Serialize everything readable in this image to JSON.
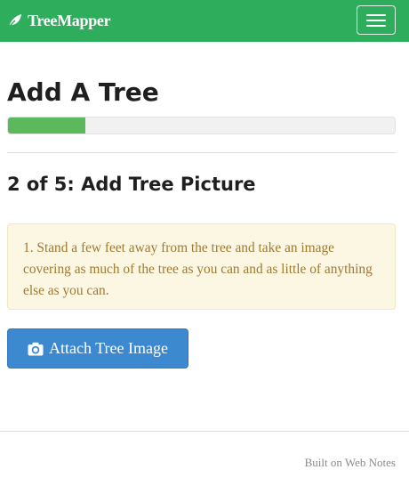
{
  "navbar": {
    "brand_label": "TreeMapper",
    "brand_icon": "leaf-icon",
    "menu_icon": "hamburger-menu-icon",
    "background_color": "#2eae5c"
  },
  "page": {
    "title": "Add A Tree",
    "progress_fraction": 0.2,
    "step_title": "2 of 5: Add Tree Picture"
  },
  "instructions": {
    "text": "1. Stand a few feet away from the tree and take an image covering as much of the tree as you can and as little of anything else as you can."
  },
  "attach_button": {
    "label": "Attach Tree Image",
    "icon": "camera-icon",
    "color": "#3d89cf"
  },
  "footer": {
    "text": "Built on Web Notes"
  }
}
